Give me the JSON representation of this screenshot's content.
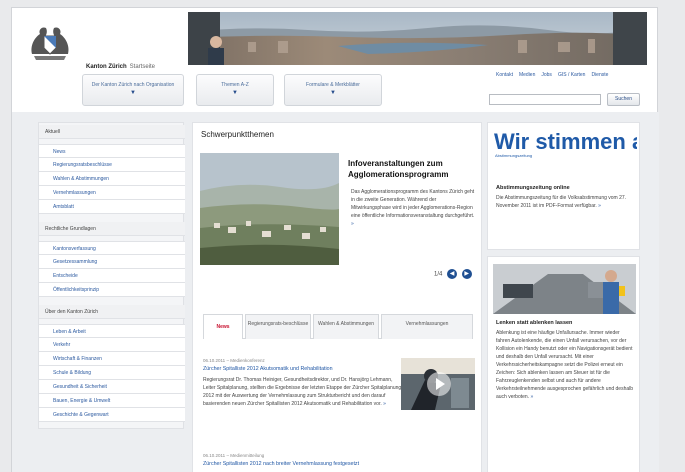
{
  "brand": {
    "name": "Kanton Zürich",
    "sub": "Startseite"
  },
  "nav": [
    {
      "label": "Der Kanton Zürich nach Organisation",
      "arrow": "▼"
    },
    {
      "label": "Themen A-Z",
      "arrow": "▼"
    },
    {
      "label": "Formulare & Merkblätter",
      "arrow": "▼"
    }
  ],
  "quicklinks": [
    "Kontakt",
    "Medien",
    "Jobs",
    "GIS / Karten",
    "Dienste"
  ],
  "search": {
    "placeholder": "",
    "button": "Suchen"
  },
  "sidebar": [
    {
      "label": "Aktuell",
      "type": "section"
    },
    {
      "label": "News",
      "type": "sub"
    },
    {
      "label": "Regierungsratsbeschlüsse",
      "type": "sub"
    },
    {
      "label": "Wahlen & Abstimmungen",
      "type": "sub"
    },
    {
      "label": "Vernehmlassungen",
      "type": "sub"
    },
    {
      "label": "Amtsblatt",
      "type": "sub"
    },
    {
      "label": "Rechtliche Grundlagen",
      "type": "section"
    },
    {
      "label": "Kantonsverfassung",
      "type": "sub"
    },
    {
      "label": "Gesetzessammlung",
      "type": "sub"
    },
    {
      "label": "Entscheide",
      "type": "sub"
    },
    {
      "label": "Öffentlichkeitsprinzip",
      "type": "sub"
    },
    {
      "label": "Über den Kanton Zürich",
      "type": "section"
    },
    {
      "label": "Leben & Arbeit",
      "type": "sub"
    },
    {
      "label": "Verkehr",
      "type": "sub"
    },
    {
      "label": "Wirtschaft & Finanzen",
      "type": "sub"
    },
    {
      "label": "Schule & Bildung",
      "type": "sub"
    },
    {
      "label": "Gesundheit & Sicherheit",
      "type": "sub"
    },
    {
      "label": "Bauen, Energie & Umwelt",
      "type": "sub"
    },
    {
      "label": "Geschichte & Gegenwart",
      "type": "sub"
    }
  ],
  "main": {
    "title": "Schwerpunktthemen",
    "teaser": {
      "title": "Infoveranstaltungen zum Agglomerationsprogramm",
      "text": "Das Agglomerationsprogramm des Kantons Zürich geht in die zweite Generation. Während der Mitwirkungsphase wird in jeder Agglomerations-Region eine öffentliche Informationsveranstaltung durchgeführt.",
      "more": "»"
    },
    "pager": {
      "count": "1/4",
      "prev": "◀",
      "next": "▶"
    },
    "tabs": [
      "News",
      "Regierungsrats-beschlüsse",
      "Wahlen & Abstimmungen",
      "Vernehmlassungen"
    ],
    "news": [
      {
        "date": "06.10.2011 – Medienkonferenz",
        "title": "Zürcher Spitalliste 2012 Akutsomatik und Rehabilitation",
        "body": "Regierungsrat Dr. Thomas Heiniger, Gesundheitsdirektor, und Dr. Hansjörg Lehmann, Leiter Spitalplanung, stellten die Ergebnisse der letzten Etappe der Zürcher Spitalplanung 2012 mit der Auswertung der Vernehmlassung zum Strukturbericht und den darauf basierenden neuen Zürcher Spitallisten 2012 Akutsomatik und Rehabilitation vor.",
        "more": "»"
      },
      {
        "date": "06.10.2011 – Medienmitteilung",
        "title": "Zürcher Spitallisten 2012 nach breiter Vernehmlassung festgesetzt",
        "body": "",
        "more": ""
      }
    ]
  },
  "right": {
    "vote": {
      "banner": "Wir stimmen a",
      "banner_small": "Abstimmungszeitung",
      "title": "Abstimmungszeitung online",
      "text": "Die Abstimmungszeitung für die Volksabstimmung vom 27. November 2011 ist im PDF-Format verfügbar.",
      "more": "»"
    },
    "road": {
      "title": "Lenken statt ablenken lassen",
      "text": "Ablenkung ist eine häufige Unfallursache. Immer wieder fahren Autolenkende, die einen Unfall verursachen, vor der Kollision ein Handy benutzt oder ein Navigationsgerät bedient und deshalb den Unfall verursacht. Mit einer Verkehrssicherheitskampagne setzt die Polizei erneut ein Zeichen: Sich ablenken lassen am Steuer ist für die Fahrzeuglenkenden selbst und auch für andere Verkehrsteilnehmende ausgesprochen gefährlich und deshalb auch verboten.",
      "more": "»"
    }
  },
  "colors": {
    "accent": "#1f56a4",
    "active_tab": "#c8102e",
    "background": "#eceef1"
  }
}
